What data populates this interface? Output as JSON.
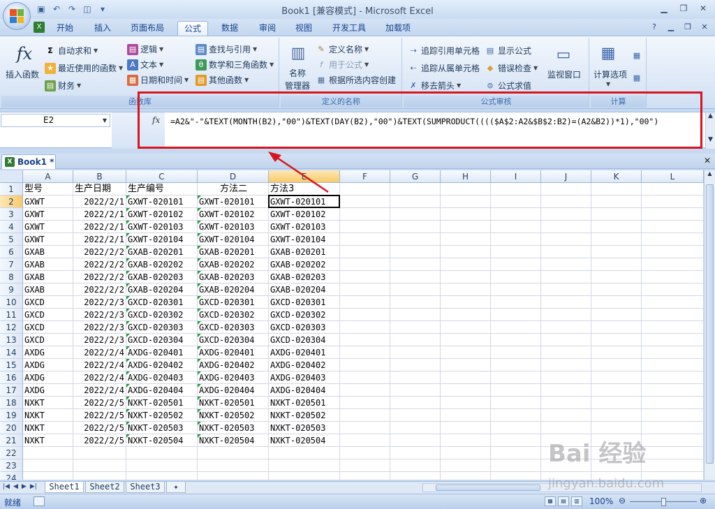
{
  "window": {
    "title": "Book1  [兼容模式] - Microsoft Excel"
  },
  "tabs": [
    "开始",
    "插入",
    "页面布局",
    "公式",
    "数据",
    "审阅",
    "视图",
    "开发工具",
    "加载项"
  ],
  "active_tab": "公式",
  "ribbon": {
    "insert_function": "插入函数",
    "autosum": "自动求和",
    "recent": "最近使用的函数",
    "finance": "财务",
    "logic": "逻辑",
    "text": "文本",
    "datetime": "日期和时间",
    "lookup": "查找与引用",
    "math": "数学和三角函数",
    "other": "其他函数",
    "group_library": "函数库",
    "name_manager_1": "名称",
    "name_manager_2": "管理器",
    "define_name": "定义名称",
    "use_in_formula": "用于公式",
    "create_from_sel": "根据所选内容创建",
    "group_names": "定义的名称",
    "trace_precedents": "追踪引用单元格",
    "trace_dependents": "追踪从属单元格",
    "remove_arrows": "移去箭头",
    "show_formulas": "显示公式",
    "error_check": "错误检查",
    "evaluate": "公式求值",
    "watch_window": "监视窗口",
    "group_audit": "公式审核",
    "calc_options": "计算选项",
    "group_calc": "计算"
  },
  "formula_bar": {
    "name_box": "E2",
    "fx": "fx",
    "formula": "=A2&\"-\"&TEXT(MONTH(B2),\"00\")&TEXT(DAY(B2),\"00\")&TEXT(SUMPRODUCT(((($A$2:A2&$B$2:B2)=(A2&B2))*1),\"00\")"
  },
  "workbook_tab": "Book1 *",
  "columns": [
    "A",
    "B",
    "C",
    "D",
    "E",
    "F",
    "G",
    "H",
    "I",
    "J",
    "K",
    "L"
  ],
  "headers": [
    "型号",
    "生产日期",
    "生产编号",
    "方法二",
    "方法3"
  ],
  "rows": [
    [
      "GXWT",
      "2022/2/1",
      "GXWT-020101",
      "GXWT-020101",
      "GXWT-020101"
    ],
    [
      "GXWT",
      "2022/2/1",
      "GXWT-020102",
      "GXWT-020102",
      "GXWT-020102"
    ],
    [
      "GXWT",
      "2022/2/1",
      "GXWT-020103",
      "GXWT-020103",
      "GXWT-020103"
    ],
    [
      "GXWT",
      "2022/2/1",
      "GXWT-020104",
      "GXWT-020104",
      "GXWT-020104"
    ],
    [
      "GXAB",
      "2022/2/2",
      "GXAB-020201",
      "GXAB-020201",
      "GXAB-020201"
    ],
    [
      "GXAB",
      "2022/2/2",
      "GXAB-020202",
      "GXAB-020202",
      "GXAB-020202"
    ],
    [
      "GXAB",
      "2022/2/2",
      "GXAB-020203",
      "GXAB-020203",
      "GXAB-020203"
    ],
    [
      "GXAB",
      "2022/2/2",
      "GXAB-020204",
      "GXAB-020204",
      "GXAB-020204"
    ],
    [
      "GXCD",
      "2022/2/3",
      "GXCD-020301",
      "GXCD-020301",
      "GXCD-020301"
    ],
    [
      "GXCD",
      "2022/2/3",
      "GXCD-020302",
      "GXCD-020302",
      "GXCD-020302"
    ],
    [
      "GXCD",
      "2022/2/3",
      "GXCD-020303",
      "GXCD-020303",
      "GXCD-020303"
    ],
    [
      "GXCD",
      "2022/2/3",
      "GXCD-020304",
      "GXCD-020304",
      "GXCD-020304"
    ],
    [
      "AXDG",
      "2022/2/4",
      "AXDG-020401",
      "AXDG-020401",
      "AXDG-020401"
    ],
    [
      "AXDG",
      "2022/2/4",
      "AXDG-020402",
      "AXDG-020402",
      "AXDG-020402"
    ],
    [
      "AXDG",
      "2022/2/4",
      "AXDG-020403",
      "AXDG-020403",
      "AXDG-020403"
    ],
    [
      "AXDG",
      "2022/2/4",
      "AXDG-020404",
      "AXDG-020404",
      "AXDG-020404"
    ],
    [
      "NXKT",
      "2022/2/5",
      "NXKT-020501",
      "NXKT-020501",
      "NXKT-020501"
    ],
    [
      "NXKT",
      "2022/2/5",
      "NXKT-020502",
      "NXKT-020502",
      "NXKT-020502"
    ],
    [
      "NXKT",
      "2022/2/5",
      "NXKT-020503",
      "NXKT-020503",
      "NXKT-020503"
    ],
    [
      "NXKT",
      "2022/2/5",
      "NXKT-020504",
      "NXKT-020504",
      "NXKT-020504"
    ]
  ],
  "row_numbers": [
    "1",
    "2",
    "3",
    "4",
    "5",
    "6",
    "7",
    "8",
    "9",
    "10",
    "11",
    "12",
    "13",
    "14",
    "15",
    "16",
    "17",
    "18",
    "19",
    "20",
    "21",
    "22",
    "23",
    "24"
  ],
  "sheets": [
    "Sheet1",
    "Sheet2",
    "Sheet3"
  ],
  "status": "就绪",
  "zoom": "100%",
  "watermark": "Bai 经验",
  "watermark_url": "jingyan.baidu.com",
  "colors": {
    "highlight_box": "#d9141e",
    "accent": "#15428b"
  }
}
